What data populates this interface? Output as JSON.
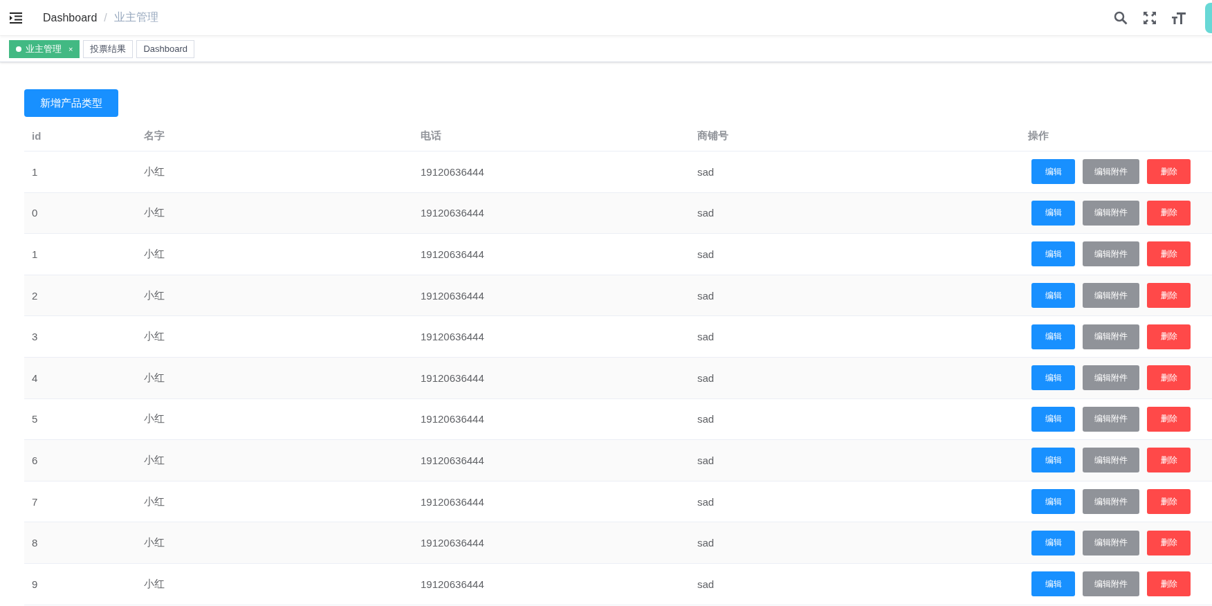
{
  "breadcrumb": {
    "separator": "/",
    "items": [
      {
        "label": "Dashboard",
        "selected": false
      },
      {
        "label": "业主管理",
        "selected": true
      }
    ]
  },
  "tags": [
    {
      "label": "业主管理",
      "selected": true,
      "close": "×"
    },
    {
      "label": "投票结果",
      "selected": false
    },
    {
      "label": "Dashboard",
      "selected": false
    }
  ],
  "add_button": "新增产品类型",
  "table": {
    "columns": [
      "id",
      "名字",
      "电话",
      "商铺号",
      "操作"
    ],
    "rows": [
      {
        "id": "1",
        "name": "小红",
        "phone": "19120636444",
        "shop": "sad",
        "actions": [
          {
            "label": "编辑",
            "kind": "primary"
          },
          {
            "label": "编辑附件",
            "kind": "info"
          },
          {
            "label": "删除",
            "kind": "danger"
          }
        ]
      },
      {
        "id": "0",
        "name": "小红",
        "phone": "19120636444",
        "shop": "sad",
        "actions": [
          {
            "label": "编辑",
            "kind": "primary"
          },
          {
            "label": "编辑附件",
            "kind": "info"
          },
          {
            "label": "删除",
            "kind": "danger"
          }
        ]
      },
      {
        "id": "1",
        "name": "小红",
        "phone": "19120636444",
        "shop": "sad",
        "actions": [
          {
            "label": "编辑",
            "kind": "primary"
          },
          {
            "label": "编辑附件",
            "kind": "info"
          },
          {
            "label": "删除",
            "kind": "danger"
          }
        ]
      },
      {
        "id": "2",
        "name": "小红",
        "phone": "19120636444",
        "shop": "sad",
        "actions": [
          {
            "label": "编辑",
            "kind": "primary"
          },
          {
            "label": "编辑附件",
            "kind": "info"
          },
          {
            "label": "删除",
            "kind": "danger"
          }
        ]
      },
      {
        "id": "3",
        "name": "小红",
        "phone": "19120636444",
        "shop": "sad",
        "actions": [
          {
            "label": "编辑",
            "kind": "primary"
          },
          {
            "label": "编辑附件",
            "kind": "info"
          },
          {
            "label": "删除",
            "kind": "danger"
          }
        ]
      },
      {
        "id": "4",
        "name": "小红",
        "phone": "19120636444",
        "shop": "sad",
        "actions": [
          {
            "label": "编辑",
            "kind": "primary"
          },
          {
            "label": "编辑附件",
            "kind": "info"
          },
          {
            "label": "删除",
            "kind": "danger"
          }
        ]
      },
      {
        "id": "5",
        "name": "小红",
        "phone": "19120636444",
        "shop": "sad",
        "actions": [
          {
            "label": "编辑",
            "kind": "primary"
          },
          {
            "label": "编辑附件",
            "kind": "info"
          },
          {
            "label": "删除",
            "kind": "danger"
          }
        ]
      },
      {
        "id": "6",
        "name": "小红",
        "phone": "19120636444",
        "shop": "sad",
        "actions": [
          {
            "label": "编辑",
            "kind": "primary"
          },
          {
            "label": "编辑附件",
            "kind": "info"
          },
          {
            "label": "删除",
            "kind": "danger"
          }
        ]
      },
      {
        "id": "7",
        "name": "小红",
        "phone": "19120636444",
        "shop": "sad",
        "actions": [
          {
            "label": "编辑",
            "kind": "primary"
          },
          {
            "label": "编辑附件",
            "kind": "info"
          },
          {
            "label": "删除",
            "kind": "danger"
          }
        ]
      },
      {
        "id": "8",
        "name": "小红",
        "phone": "19120636444",
        "shop": "sad",
        "actions": [
          {
            "label": "编辑",
            "kind": "primary"
          },
          {
            "label": "编辑附件",
            "kind": "info"
          },
          {
            "label": "删除",
            "kind": "danger"
          }
        ]
      },
      {
        "id": "9",
        "name": "小红",
        "phone": "19120636444",
        "shop": "sad",
        "actions": [
          {
            "label": "编辑",
            "kind": "primary"
          },
          {
            "label": "编辑附件",
            "kind": "info"
          },
          {
            "label": "删除",
            "kind": "danger"
          }
        ]
      }
    ]
  }
}
